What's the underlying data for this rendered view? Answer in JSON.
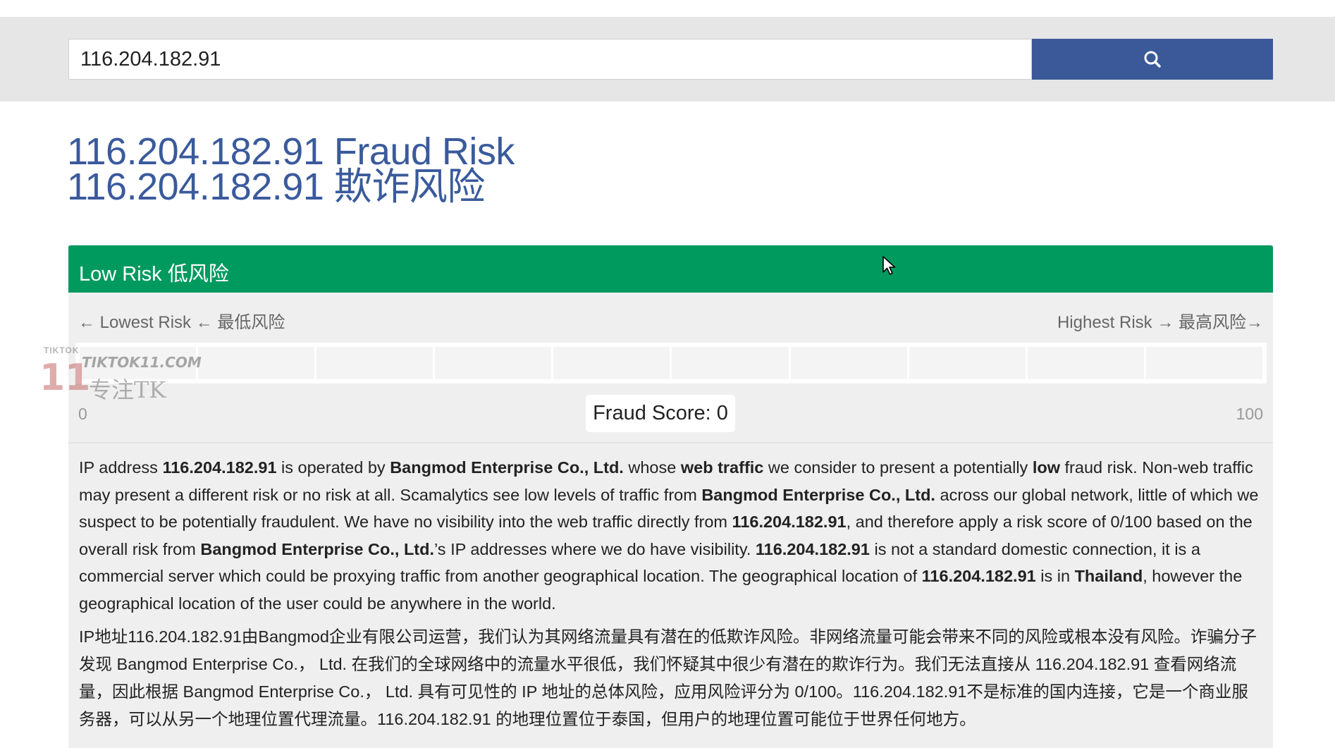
{
  "search": {
    "value": "116.204.182.91",
    "button_icon": "search-icon"
  },
  "title": {
    "line1": "116.204.182.91 Fraud Risk",
    "line2": "116.204.182.91 欺诈风险"
  },
  "risk": {
    "label": "Low Risk 低风险",
    "color": "#009a5f",
    "scale_left": "← Lowest Risk ← 最低风险",
    "scale_right": "Highest Risk → 最高风险→",
    "tick_min": "0",
    "tick_max": "100",
    "score_label": "Fraud Score: 0",
    "score_value": 0,
    "segments": 10
  },
  "description": {
    "en": [
      {
        "t": "IP address ",
        "b": false
      },
      {
        "t": "116.204.182.91",
        "b": true
      },
      {
        "t": " is operated by ",
        "b": false
      },
      {
        "t": "Bangmod Enterprise Co., Ltd.",
        "b": true
      },
      {
        "t": " whose ",
        "b": false
      },
      {
        "t": "web traffic",
        "b": true
      },
      {
        "t": " we consider to present a potentially ",
        "b": false
      },
      {
        "t": "low",
        "b": true
      },
      {
        "t": " fraud risk. Non-web traffic may present a different risk or no risk at all. Scamalytics see low levels of traffic from ",
        "b": false
      },
      {
        "t": "Bangmod Enterprise Co., Ltd.",
        "b": true
      },
      {
        "t": " across our global network, little of which we suspect to be potentially fraudulent. We have no visibility into the web traffic directly from ",
        "b": false
      },
      {
        "t": "116.204.182.91",
        "b": true
      },
      {
        "t": ", and therefore apply a risk score of 0/100 based on the overall risk from ",
        "b": false
      },
      {
        "t": "Bangmod Enterprise Co., Ltd.",
        "b": true
      },
      {
        "t": "’s IP addresses where we do have visibility. ",
        "b": false
      },
      {
        "t": "116.204.182.91",
        "b": true
      },
      {
        "t": " is not a standard domestic connection, it is a commercial server which could be proxying traffic from another geographical location. The geographical location of ",
        "b": false
      },
      {
        "t": "116.204.182.91",
        "b": true
      },
      {
        "t": " is in ",
        "b": false
      },
      {
        "t": "Thailand",
        "b": true
      },
      {
        "t": ", however the geographical location of the user could be anywhere in the world.",
        "b": false
      }
    ],
    "zh": "IP地址116.204.182.91由Bangmod企业有限公司运营，我们认为其网络流量具有潜在的低欺诈风险。非网络流量可能会带来不同的风险或根本没有风险。诈骗分子发现 Bangmod Enterprise Co.， Ltd. 在我们的全球网络中的流量水平很低，我们怀疑其中很少有潜在的欺诈行为。我们无法直接从 116.204.182.91 查看网络流量，因此根据 Bangmod Enterprise Co.， Ltd. 具有可见性的 IP 地址的总体风险，应用风险评分为 0/100。116.204.182.91不是标准的国内连接，它是一个商业服务器，可以从另一个地理位置代理流量。116.204.182.91 的地理位置位于泰国，但用户的地理位置可能位于世界任何地方。"
  },
  "watermark": {
    "top": "TIKTOK",
    "number": "11",
    "site": "TIKTOK11.COM",
    "tagline": "专注TK"
  }
}
